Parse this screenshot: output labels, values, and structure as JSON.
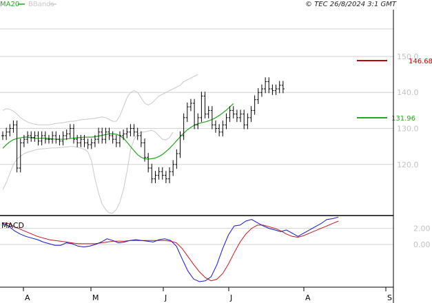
{
  "header": {
    "copyright": "© TEC 26/8/2024 3:1 GMT",
    "legend": [
      {
        "label": "MA20",
        "color": "#22a61c"
      },
      {
        "label": "BBands",
        "color": "#c8c8c8"
      }
    ]
  },
  "markers": {
    "resistance": {
      "label": "146.68",
      "value": 146.68,
      "color": "#c30000"
    },
    "support": {
      "label": "131.96",
      "value": 131.96,
      "color": "#22a61c"
    }
  },
  "chart_data": [
    {
      "type": "line",
      "title": "",
      "price_axis": {
        "ticks": [
          "150.0",
          "140.0",
          "130.0",
          "120.0"
        ],
        "tick_values": [
          150,
          140,
          130,
          120
        ],
        "ylim": [
          106,
          163
        ]
      },
      "x_ticks": [
        "A",
        "M",
        "J",
        "J",
        "A",
        "S"
      ],
      "x_tick_index": [
        0,
        19,
        38,
        56,
        78,
        100
      ],
      "grid": true,
      "series": [
        {
          "name": "",
          "kind": "ohlc-close",
          "values": [
            128.0,
            129.0,
            130.0,
            131.0,
            119.0,
            126.0,
            127.0,
            128.0,
            127.5,
            128.0,
            126.5,
            128.0,
            127.0,
            127.0,
            128.0,
            127.0,
            126.5,
            128.0,
            128.5,
            130.0,
            127.0,
            126.0,
            127.0,
            126.0,
            125.5,
            126.0,
            127.0,
            129.0,
            127.0,
            129.0,
            128.0,
            127.0,
            126.0,
            128.0,
            128.5,
            129.0,
            130.0,
            129.0,
            128.0,
            126.0,
            122.0,
            119.0,
            116.0,
            117.0,
            118.0,
            117.0,
            116.0,
            118.0,
            120.0,
            123.0,
            128.0,
            133.0,
            136.0,
            137.0,
            131.0,
            133.0,
            139.0,
            134.0,
            135.0,
            131.0,
            130.0,
            129.0,
            131.0,
            133.0,
            135.0,
            134.0,
            133.0,
            134.0,
            131.0,
            133.0,
            135.0,
            138.0,
            140.0,
            141.0,
            143.0,
            141.0,
            140.5,
            141.0,
            142.0,
            141.0
          ]
        },
        {
          "name": "MA20",
          "values": [
            124.5,
            125.5,
            126.3,
            126.9,
            127.2,
            127.4,
            127.6,
            127.6,
            127.4,
            127.3,
            127.2,
            127.3,
            127.3,
            127.2,
            127.1,
            127.0,
            127.0,
            127.0,
            127.1,
            127.2,
            127.3,
            127.4,
            127.5,
            127.6,
            127.6,
            127.6,
            127.7,
            127.9,
            128.1,
            128.3,
            128.5,
            128.5,
            128.4,
            128.0,
            127.3,
            126.2,
            125.0,
            123.8,
            122.7,
            122.0,
            121.6,
            121.5,
            121.6,
            121.8,
            122.2,
            122.8,
            123.6,
            124.5,
            125.5,
            126.6,
            127.7,
            128.7,
            129.6,
            130.3,
            130.9,
            131.3,
            131.6,
            131.8,
            132.1,
            132.5,
            133.0,
            133.6,
            134.3,
            135.1,
            136.0,
            136.9
          ]
        },
        {
          "name": "BBands upper",
          "values": [
            135.0,
            135.5,
            135.3,
            134.8,
            134.0,
            133.0,
            132.3,
            131.8,
            131.4,
            131.2,
            131.0,
            131.0,
            131.0,
            131.0,
            131.2,
            131.4,
            131.5,
            131.6,
            131.8,
            132.0,
            132.0,
            132.2,
            132.4,
            132.5,
            132.6,
            132.7,
            132.8,
            133.0,
            133.2,
            133.0,
            132.5,
            132.0,
            132.0,
            133.5,
            136.0,
            138.5,
            140.0,
            140.5,
            140.0,
            138.5,
            137.0,
            136.5,
            137.0,
            138.0,
            139.0,
            139.5,
            140.0,
            140.5,
            141.0,
            141.5,
            142.0,
            143.0,
            143.5,
            144.0,
            144.5,
            145.0
          ]
        },
        {
          "name": "BBands lower",
          "values": [
            113.0,
            115.0,
            117.5,
            120.0,
            121.5,
            122.3,
            123.0,
            123.4,
            123.7,
            124.0,
            124.2,
            124.3,
            124.4,
            124.5,
            124.6,
            124.6,
            124.7,
            124.8,
            124.9,
            125.0,
            125.0,
            124.8,
            124.5,
            124.2,
            123.5,
            121.0,
            116.0,
            112.0,
            109.0,
            107.5,
            106.5,
            106.5,
            107.5,
            109.5,
            113.0,
            118.0,
            124.0,
            127.0,
            128.5,
            129.0,
            129.0,
            129.3,
            129.5,
            129.0,
            128.0,
            127.0,
            126.8,
            127.5,
            129.0
          ]
        }
      ]
    },
    {
      "type": "line",
      "title": "MACD",
      "ticks": [
        "2.00",
        "0.00"
      ],
      "tick_values": [
        2.0,
        0.0
      ],
      "ylim": [
        -5.2,
        3.5
      ],
      "series": [
        {
          "name": "",
          "color": "#1414c8",
          "values": [
            2.6,
            2.3,
            1.7,
            1.3,
            1.0,
            0.8,
            0.6,
            0.3,
            0.1,
            -0.1,
            -0.1,
            0.2,
            0.1,
            -0.2,
            -0.3,
            -0.2,
            0.0,
            0.3,
            0.7,
            0.5,
            0.2,
            0.3,
            0.5,
            0.6,
            0.5,
            0.4,
            0.3,
            0.6,
            0.7,
            0.5,
            -0.2,
            -1.8,
            -3.3,
            -4.3,
            -4.6,
            -4.5,
            -4.0,
            -2.5,
            -0.5,
            1.2,
            2.3,
            2.4,
            2.9,
            3.1,
            2.7,
            2.3,
            2.0,
            1.8,
            1.6,
            1.8,
            1.4,
            1.0,
            1.4,
            1.8,
            2.2,
            2.6,
            3.1,
            3.2,
            3.4
          ]
        },
        {
          "name": "",
          "color": "#c81414",
          "values": [
            2.7,
            2.6,
            2.2,
            1.9,
            1.6,
            1.3,
            1.0,
            0.8,
            0.6,
            0.5,
            0.4,
            0.3,
            0.2,
            0.1,
            0.1,
            0.1,
            0.1,
            0.2,
            0.3,
            0.4,
            0.4,
            0.4,
            0.5,
            0.5,
            0.5,
            0.5,
            0.5,
            0.5,
            0.5,
            0.4,
            0.2,
            -0.5,
            -1.5,
            -2.5,
            -3.4,
            -4.1,
            -4.5,
            -4.3,
            -3.6,
            -2.4,
            -1.0,
            0.3,
            1.3,
            2.0,
            2.4,
            2.4,
            2.2,
            2.0,
            1.7,
            1.3,
            1.0,
            0.9,
            1.1,
            1.4,
            1.7,
            2.0,
            2.3,
            2.6,
            2.9
          ]
        }
      ]
    }
  ]
}
